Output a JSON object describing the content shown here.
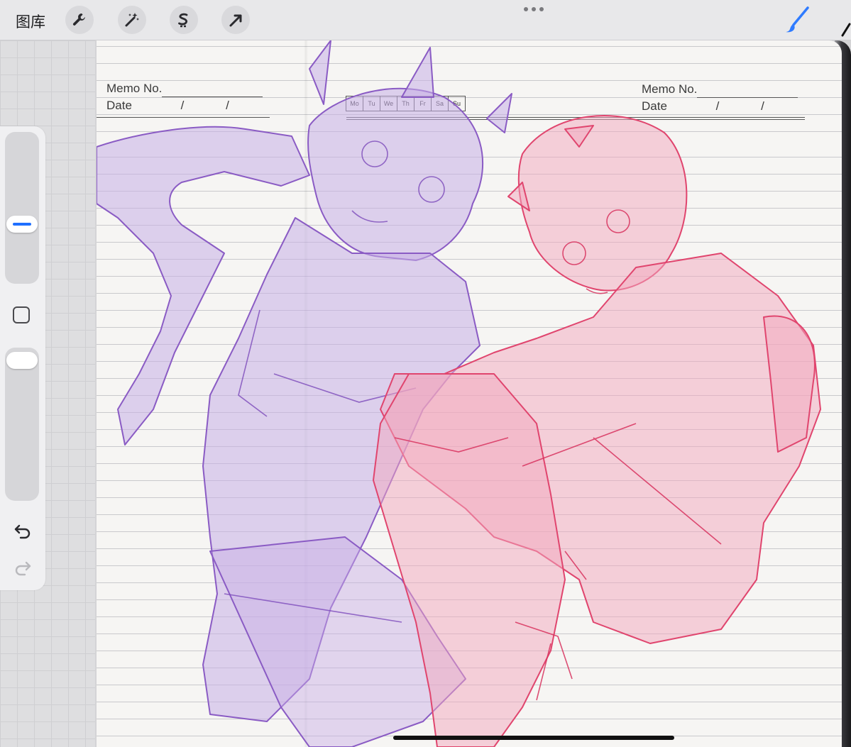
{
  "toolbar": {
    "gallery_label": "图库",
    "tools": [
      {
        "name": "actions",
        "icon": "wrench-icon"
      },
      {
        "name": "adjustments",
        "icon": "magic-wand-icon"
      },
      {
        "name": "selection",
        "icon": "selection-s-icon"
      },
      {
        "name": "transform",
        "icon": "arrow-icon"
      }
    ],
    "right_tools": [
      {
        "name": "brush",
        "icon": "brush-icon",
        "color": "#2f7bff"
      }
    ]
  },
  "sidebar": {
    "brush_size_level": 0.38,
    "opacity_level": 1.0,
    "modify_icon": "square-icon",
    "undo_icon": "undo-icon",
    "redo_icon": "redo-icon"
  },
  "page": {
    "left_memo_label": "Memo No.",
    "left_date_label": "Date",
    "right_memo_label": "Memo No.",
    "right_date_label": "Date",
    "date_separator": "/",
    "weekdays": [
      "Mo",
      "Tu",
      "We",
      "Th",
      "Fr",
      "Sa",
      "Su"
    ]
  },
  "colors": {
    "purple_sketch": "#9b6ccf",
    "pink_sketch": "#e0456e",
    "accent": "#2f7bff"
  }
}
